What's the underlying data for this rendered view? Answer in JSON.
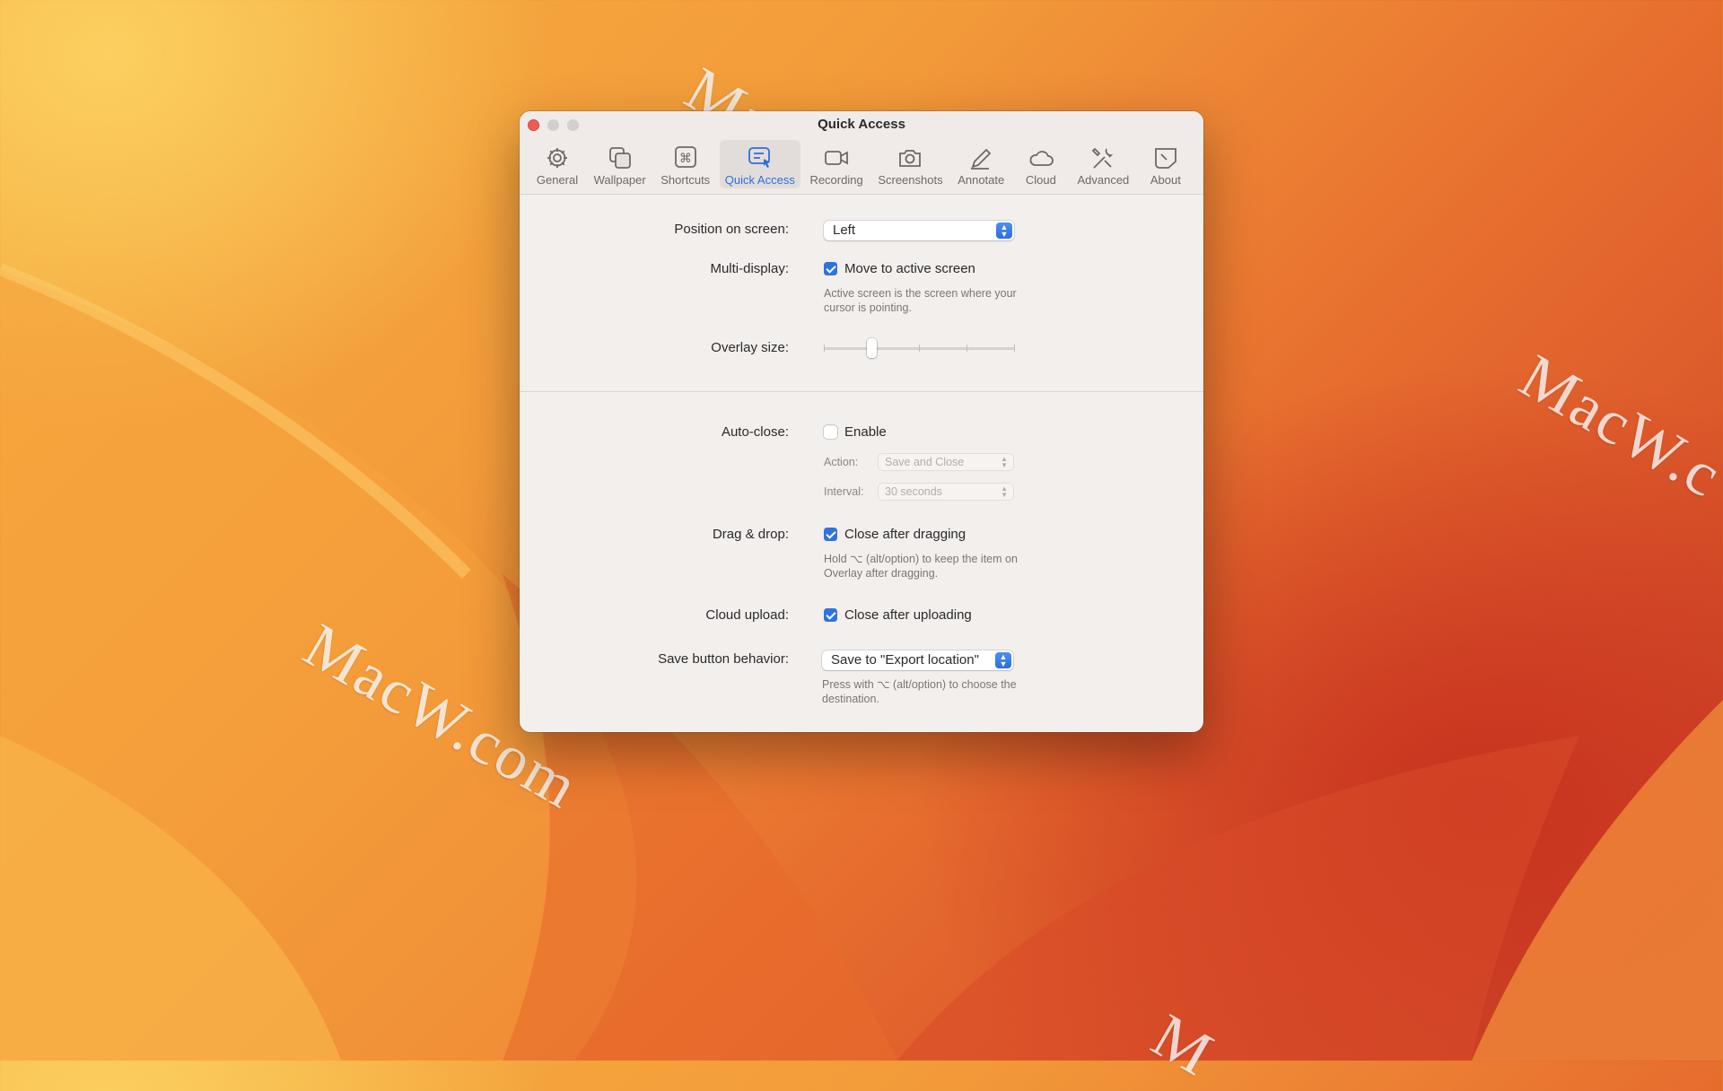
{
  "window": {
    "title": "Quick Access"
  },
  "tabs": [
    {
      "label": "General",
      "icon": "gear-icon"
    },
    {
      "label": "Wallpaper",
      "icon": "wallpaper-icon"
    },
    {
      "label": "Shortcuts",
      "icon": "command-key-icon"
    },
    {
      "label": "Quick Access",
      "icon": "quick-access-icon",
      "active": true
    },
    {
      "label": "Recording",
      "icon": "video-camera-icon"
    },
    {
      "label": "Screenshots",
      "icon": "camera-icon"
    },
    {
      "label": "Annotate",
      "icon": "pencil-icon"
    },
    {
      "label": "Cloud",
      "icon": "cloud-icon"
    },
    {
      "label": "Advanced",
      "icon": "tools-icon"
    },
    {
      "label": "About",
      "icon": "about-icon"
    }
  ],
  "settings": {
    "position": {
      "label": "Position on screen:",
      "value": "Left"
    },
    "multi_display": {
      "label": "Multi-display:",
      "checkbox": "Move to active screen",
      "checked": true,
      "hint": "Active screen is the screen where your cursor is pointing."
    },
    "overlay_size": {
      "label": "Overlay size:",
      "level_fraction": 0.25
    },
    "auto_close": {
      "label": "Auto-close:",
      "checkbox": "Enable",
      "checked": false,
      "action_label": "Action:",
      "action_value": "Save and Close",
      "interval_label": "Interval:",
      "interval_value": "30 seconds"
    },
    "drag_drop": {
      "label": "Drag & drop:",
      "checkbox": "Close after dragging",
      "checked": true,
      "hint": "Hold ⌥ (alt/option) to keep the item on Overlay after dragging."
    },
    "cloud_upload": {
      "label": "Cloud upload:",
      "checkbox": "Close after uploading",
      "checked": true
    },
    "save_button": {
      "label": "Save button behavior:",
      "value": "Save to \"Export location\"",
      "hint": "Press with ⌥ (alt/option) to choose the destination."
    }
  },
  "watermarks": [
    "MacW.com",
    "MacW.com",
    "MacW.c",
    "M"
  ],
  "colors": {
    "accent": "#2f73de",
    "close_button": "#ee5d55"
  }
}
